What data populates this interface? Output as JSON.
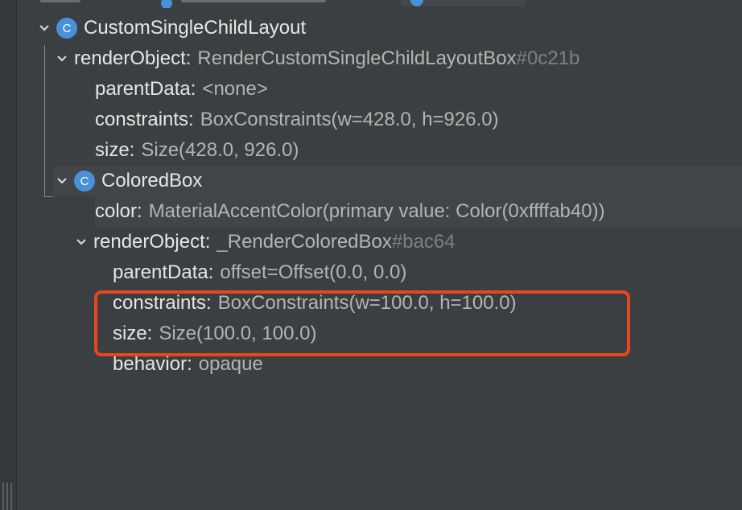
{
  "colors": {
    "background": "#3c3f41",
    "badge": "#4a90d9",
    "highlight": "#e8461e"
  },
  "tree": {
    "node1": {
      "badge": "C",
      "name": "CustomSingleChildLayout"
    },
    "ro1": {
      "key": "renderObject:",
      "value": "RenderCustomSingleChildLayoutBox",
      "id": "#0c21b"
    },
    "ro1_parentData": {
      "key": "parentData:",
      "value": "<none>"
    },
    "ro1_constraints": {
      "key": "constraints:",
      "value": "BoxConstraints(w=428.0, h=926.0)"
    },
    "ro1_size": {
      "key": "size:",
      "value": "Size(428.0, 926.0)"
    },
    "node2": {
      "badge": "C",
      "name": "ColoredBox"
    },
    "color": {
      "key": "color:",
      "value": "MaterialAccentColor(primary value: Color(0xffffab40))"
    },
    "ro2": {
      "key": "renderObject:",
      "value": "_RenderColoredBox",
      "id": "#bac64"
    },
    "ro2_parentData": {
      "key": "parentData:",
      "value": "offset=Offset(0.0, 0.0)"
    },
    "ro2_constraints": {
      "key": "constraints:",
      "value": "BoxConstraints(w=100.0, h=100.0)"
    },
    "ro2_size": {
      "key": "size:",
      "value": "Size(100.0, 100.0)"
    },
    "ro2_behavior": {
      "key": "behavior:",
      "value": "opaque"
    }
  }
}
